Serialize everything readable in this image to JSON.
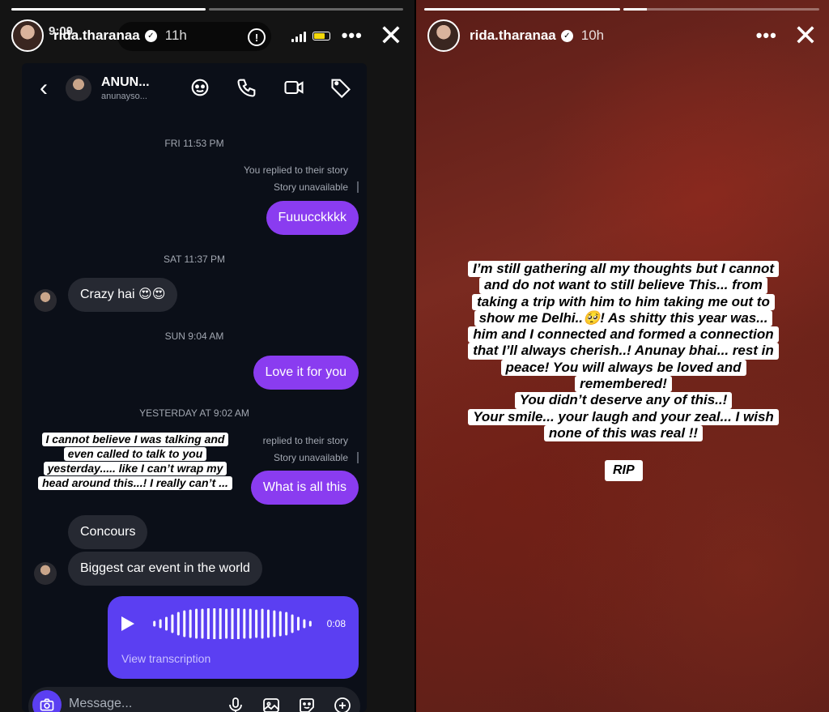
{
  "left_story": {
    "progress": [
      1.0,
      0.0
    ],
    "username": "rida.tharanaa",
    "time": "11h",
    "phone_status_time": "9:00",
    "dm": {
      "contact_name": "ANUN...",
      "contact_handle": "anunayso...",
      "ts_1": "FRI 11:53 PM",
      "sys_1a": "You replied to their story",
      "sys_1b": "Story unavailable",
      "msg_1": "Fuuucckkkk",
      "ts_2": "SAT 11:37 PM",
      "msg_2": "Crazy hai 😍😍",
      "ts_3": "SUN 9:04 AM",
      "msg_3": "Love it for you",
      "ts_4": "YESTERDAY AT 9:02 AM",
      "sys_2a": "replied to their story",
      "sys_2b": "Story unavailable",
      "msg_4": "What is all this",
      "msg_5": "Concours",
      "msg_6": "Biggest car event in the world",
      "voice_duration": "0:08",
      "voice_transcription": "View transcription",
      "message_placeholder": "Message..."
    },
    "caption_lines": [
      "I cannot believe I was talking and",
      "even called to talk to you",
      "yesterday..... like I can’t wrap my",
      "head around this...! I really can’t ..."
    ]
  },
  "right_story": {
    "progress": [
      1.0,
      0.12
    ],
    "username": "rida.tharanaa",
    "time": "10h",
    "caption_lines": [
      "I’m still gathering all my thoughts but I cannot",
      "and do not want to still believe This... from",
      "taking a trip with him to him taking me out to",
      "show me Delhi..🥺! As shitty this year was...",
      "him and I connected and formed a connection",
      "that I’ll always cherish..! Anunay bhai... rest in",
      "peace! You will always be loved and",
      "remembered!",
      "You didn’t deserve any of this..!",
      "Your smile... your laugh and your zeal... I wish",
      "none of this was real !!"
    ],
    "rip": "RIP"
  },
  "colors": {
    "outgoing_bubble": "#8a3cf0",
    "incoming_bubble": "#262932",
    "voice_bubble": "#5b3ff2",
    "dm_background": "#0b0f18"
  }
}
